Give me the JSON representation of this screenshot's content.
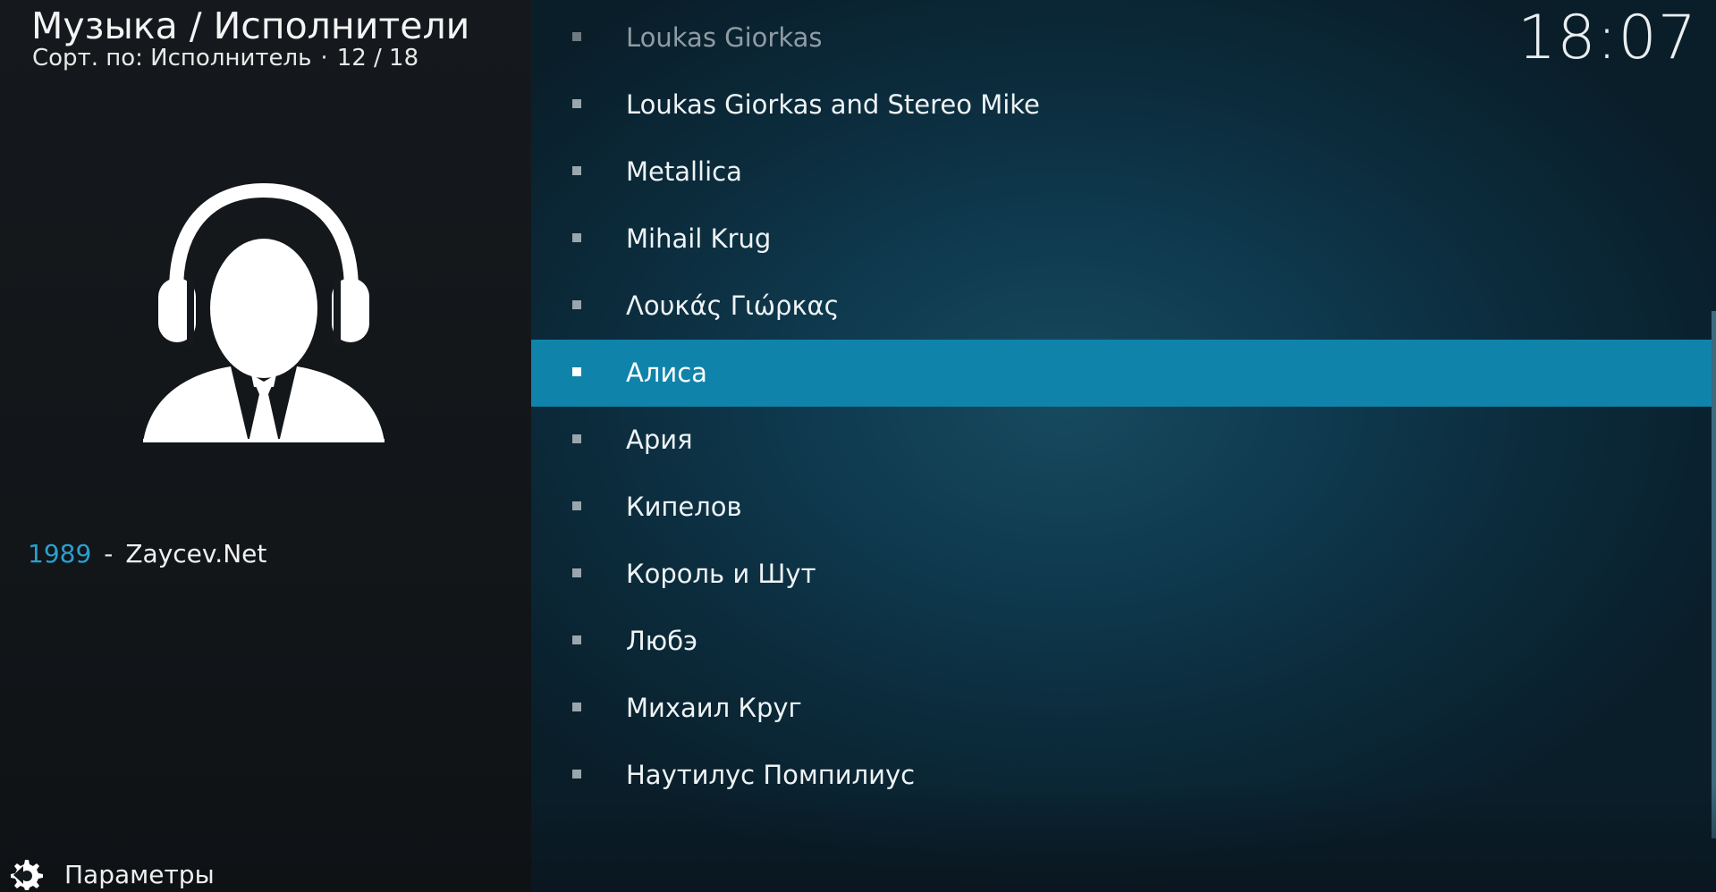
{
  "header": {
    "title": "Музыка / Исполнители",
    "sort_label": "Сорт. по: Исполнитель",
    "separator": "·",
    "position": "12 / 18"
  },
  "clock": "18:07",
  "info": {
    "year": "1989",
    "separator": "-",
    "label": "Zaycev.Net"
  },
  "settings": {
    "label": "Параметры",
    "icon": "gear-icon"
  },
  "artists": [
    {
      "name": "Loukas Giorkas",
      "state": "faded"
    },
    {
      "name": "Loukas Giorkas and Stereo Mike",
      "state": "normal"
    },
    {
      "name": "Metallica",
      "state": "normal"
    },
    {
      "name": "Mihail Krug",
      "state": "normal"
    },
    {
      "name": "Λουκάς Γιώρκας",
      "state": "normal"
    },
    {
      "name": "Алиса",
      "state": "selected"
    },
    {
      "name": "Ария",
      "state": "normal"
    },
    {
      "name": "Кипелов",
      "state": "normal"
    },
    {
      "name": "Король и Шут",
      "state": "normal"
    },
    {
      "name": "Любэ",
      "state": "normal"
    },
    {
      "name": "Михаил Круг",
      "state": "normal"
    },
    {
      "name": "Наутилус Помпилиус",
      "state": "normal"
    }
  ],
  "colors": {
    "accent": "#1083ab",
    "year": "#2a9fd0"
  }
}
